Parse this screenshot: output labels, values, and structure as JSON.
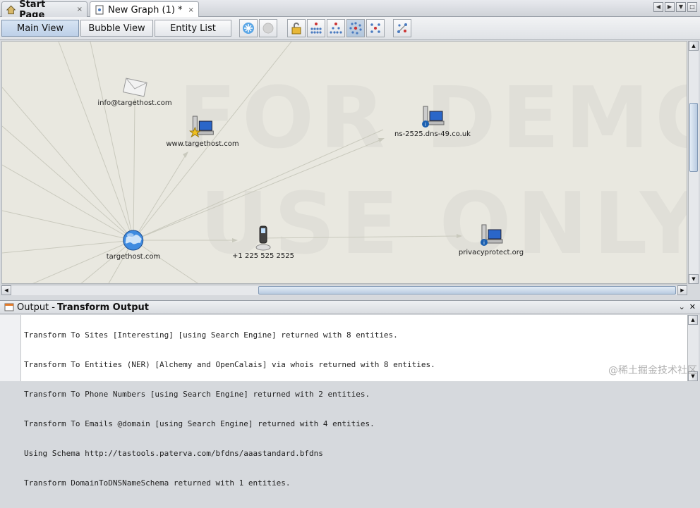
{
  "tabs": [
    {
      "label": "Start Page",
      "close": "×"
    },
    {
      "label": "New Graph (1) *",
      "close": "×"
    }
  ],
  "views": {
    "main": "Main View",
    "bubble": "Bubble View",
    "entity": "Entity List"
  },
  "graph": {
    "watermark_line1": "FOR DEMO",
    "watermark_line2": "USE ONLY",
    "nodes": [
      {
        "id": "email",
        "label": "info@targethost.com",
        "icon": "email-icon"
      },
      {
        "id": "website",
        "label": "www.targethost.com",
        "icon": "website-icon"
      },
      {
        "id": "ns",
        "label": "ns-2525.dns-49.co.uk",
        "icon": "nameserver-icon"
      },
      {
        "id": "domain",
        "label": "targethost.com",
        "icon": "globe-icon"
      },
      {
        "id": "phone",
        "label": "+1 225 525 2525",
        "icon": "phone-icon"
      },
      {
        "id": "privacy",
        "label": "privacyprotect.org",
        "icon": "server-icon"
      }
    ]
  },
  "output": {
    "prefix": "Output - ",
    "title": "Transform Output",
    "lines": [
      "Transform To Sites [Interesting] [using Search Engine] returned with 8 entities.",
      "Transform To Entities (NER) [Alchemy and OpenCalais] via whois returned with 8 entities.",
      "Transform To Phone Numbers [using Search Engine] returned with 2 entities.",
      "Transform To Emails @domain [using Search Engine] returned with 4 entities.",
      "Using Schema http://tastools.paterva.com/bfdns/aaastandard.bfdns",
      "Transform DomainToDNSNameSchema returned with 1 entities."
    ]
  },
  "corner_watermark": "@稀土掘金技术社区"
}
